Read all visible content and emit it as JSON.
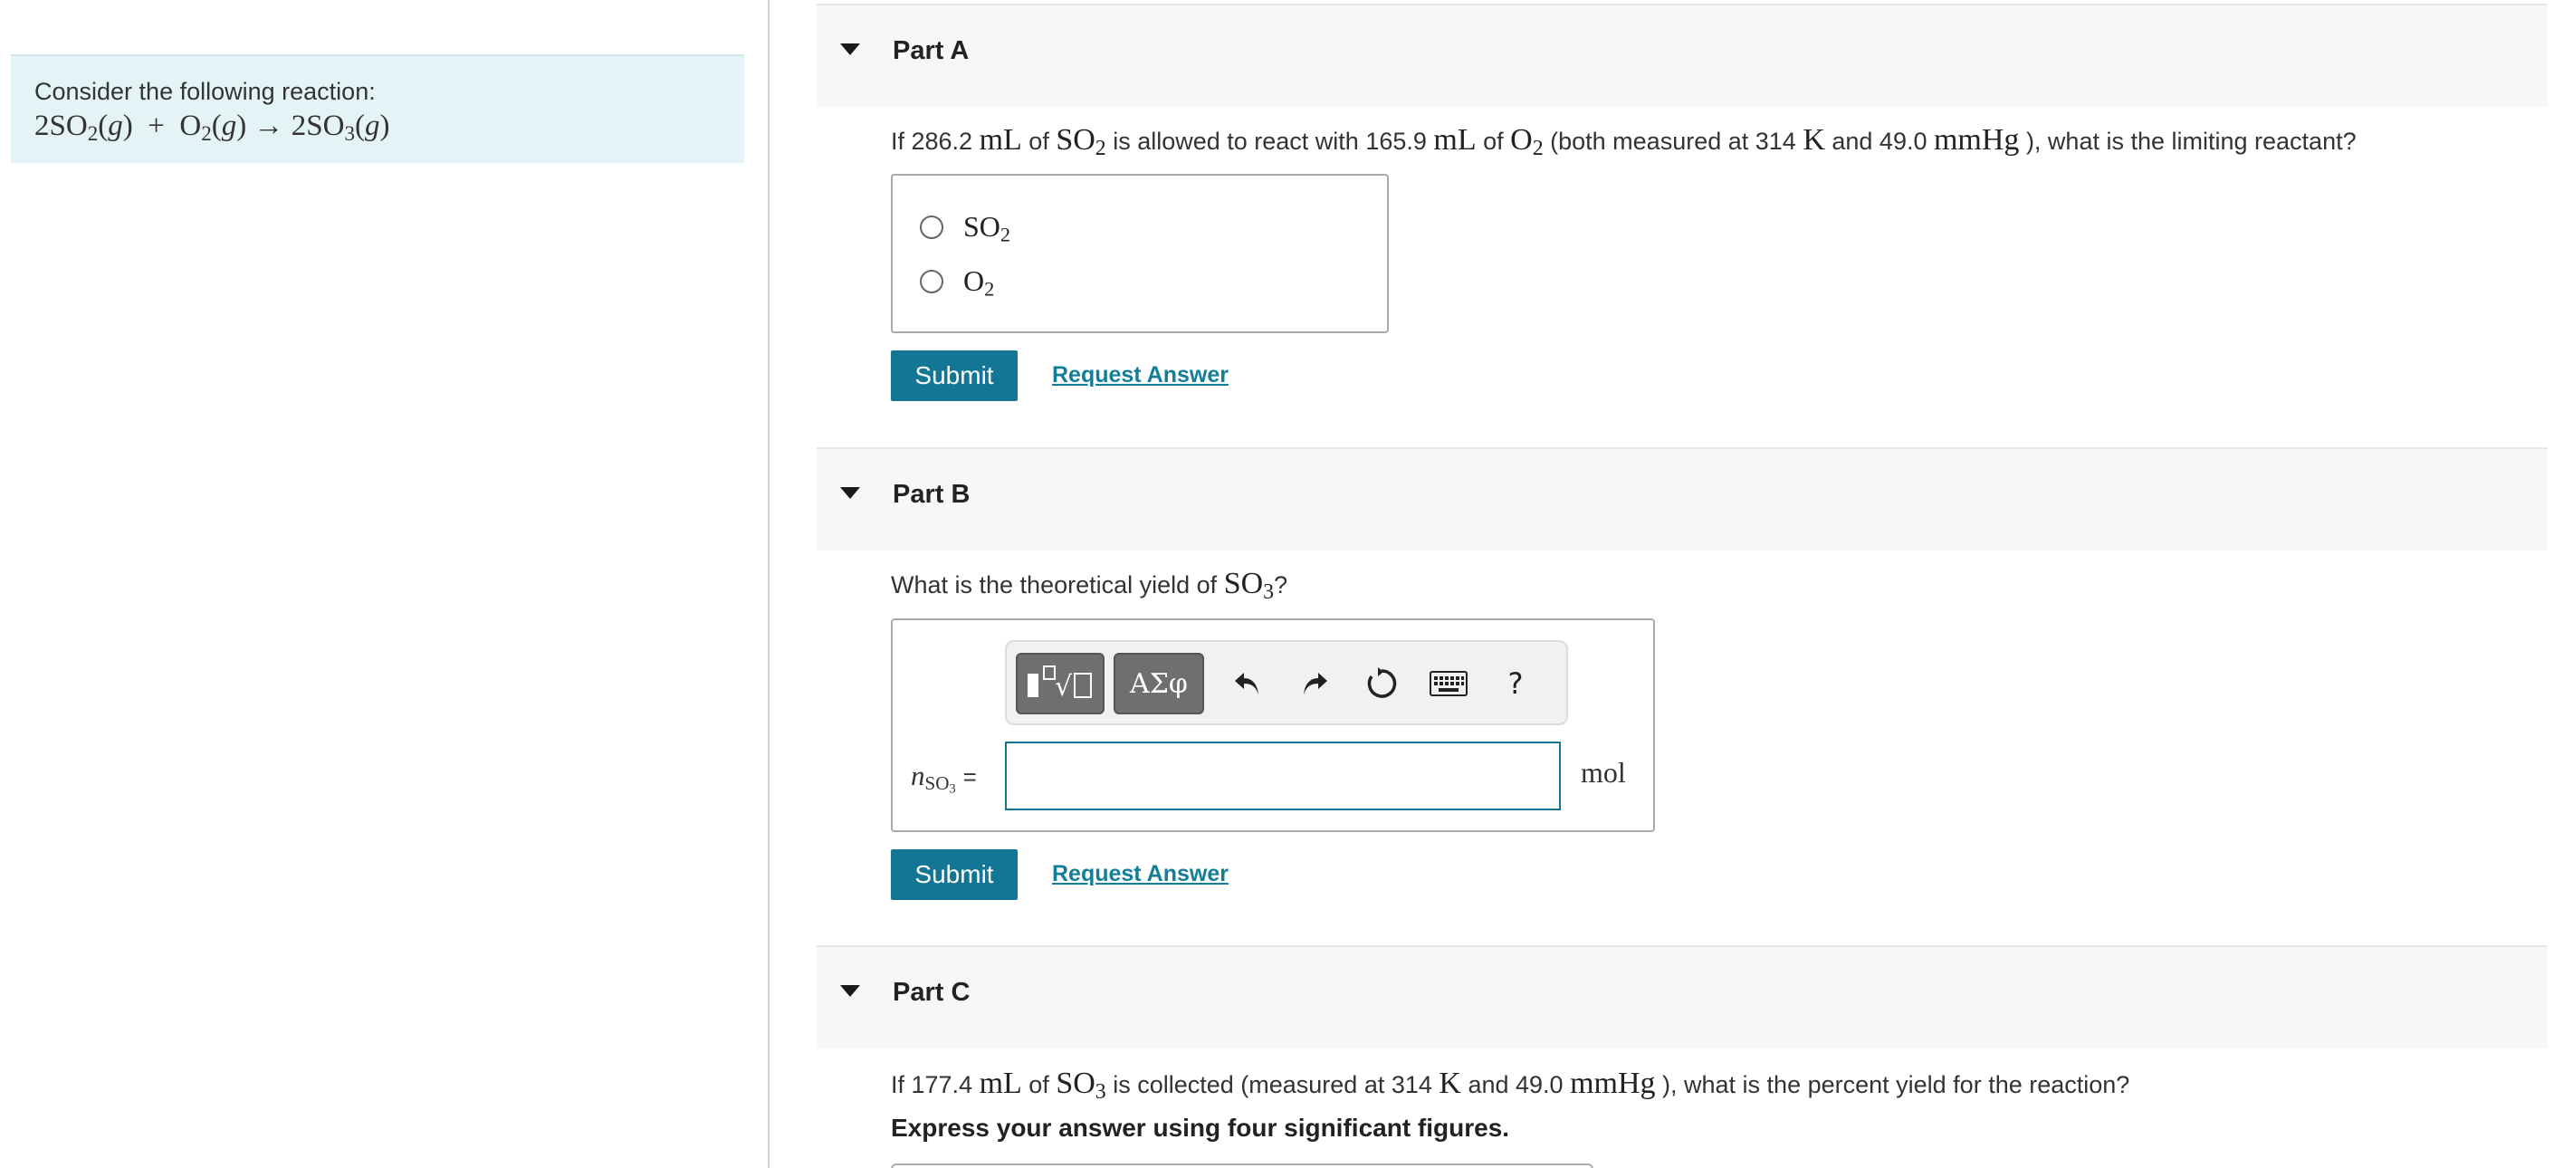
{
  "context": {
    "intro": "Consider the following reaction:",
    "reaction": {
      "r1_coef": "2",
      "r1_formula": "SO",
      "r1_sub": "2",
      "r1_state": "g",
      "plus": "+",
      "r2_formula": "O",
      "r2_sub": "2",
      "r2_state": "g",
      "arrow": "→",
      "p1_coef": "2",
      "p1_formula": "SO",
      "p1_sub": "3",
      "p1_state": "g"
    }
  },
  "partA": {
    "title": "Part A",
    "question": {
      "t1": "If 286.2 ",
      "u1": "mL",
      "t2": " of ",
      "s1": "SO",
      "s1sub": "2",
      "t3": " is allowed to react with 165.9 ",
      "u2": "mL",
      "t4": " of ",
      "s2": "O",
      "s2sub": "2",
      "t5": " (both measured at 314 ",
      "u3": "K",
      "t6": " and 49.0 ",
      "u4": "mmHg",
      "t7": " ), what is the limiting reactant?"
    },
    "choices": [
      {
        "formula": "SO",
        "sub": "2"
      },
      {
        "formula": "O",
        "sub": "2"
      }
    ],
    "submit_label": "Submit",
    "request_label": "Request Answer"
  },
  "partB": {
    "title": "Part B",
    "question": {
      "t1": "What is the theoretical yield of ",
      "s1": "SO",
      "s1sub": "3",
      "t2": "?"
    },
    "toolbar": {
      "greek_label": "ΑΣφ",
      "help_label": "?"
    },
    "var": {
      "n": "n",
      "sub_formula": "SO",
      "sub_digit": "3",
      "eq": "="
    },
    "input_value": "",
    "unit": "mol",
    "submit_label": "Submit",
    "request_label": "Request Answer"
  },
  "partC": {
    "title": "Part C",
    "question": {
      "t1": "If 177.4 ",
      "u1": "mL",
      "t2": " of ",
      "s1": "SO",
      "s1sub": "3",
      "t3": " is collected (measured at 314 ",
      "u2": "K",
      "t4": " and 49.0 ",
      "u3": "mmHg",
      "t5": " ), what is the percent yield for the reaction?"
    },
    "instruction": "Express your answer using four significant figures."
  },
  "colors": {
    "accent": "#127694",
    "context_bg": "#e4f4f6",
    "header_bg": "#f7f7f7"
  }
}
